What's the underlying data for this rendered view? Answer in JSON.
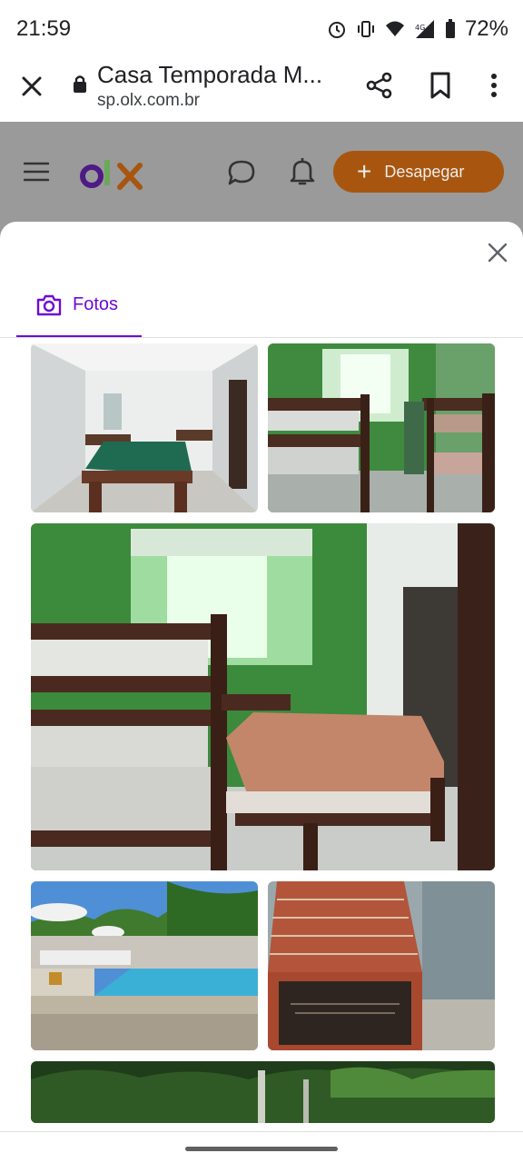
{
  "status": {
    "time": "21:59",
    "battery": "72%",
    "icons": [
      "alarm-icon",
      "vibrate-icon",
      "wifi-icon",
      "signal-icon",
      "battery-icon"
    ]
  },
  "browser": {
    "title": "Casa Temporada M...",
    "domain": "sp.olx.com.br",
    "icons": [
      "close-icon",
      "lock-icon",
      "share-icon",
      "bookmark-icon",
      "more-vert-icon"
    ]
  },
  "header": {
    "logo": {
      "letters": [
        "o",
        "l",
        "x"
      ],
      "colors": [
        "#6e0ad6",
        "#8ce563",
        "#f28000"
      ]
    },
    "cta_plus": "+",
    "cta_label": "Desapegar",
    "icons": [
      "menu-icon",
      "chat-icon",
      "bell-icon"
    ]
  },
  "modal": {
    "tab_label": "Fotos",
    "tab_icon": "camera-icon",
    "accent": "#6e0ad6",
    "photos": [
      {
        "name": "photo-pool-table-hall"
      },
      {
        "name": "photo-bunk-room"
      },
      {
        "name": "photo-green-bedroom"
      },
      {
        "name": "photo-swimming-pool"
      },
      {
        "name": "photo-brick-barbecue"
      },
      {
        "name": "photo-forest"
      }
    ]
  }
}
